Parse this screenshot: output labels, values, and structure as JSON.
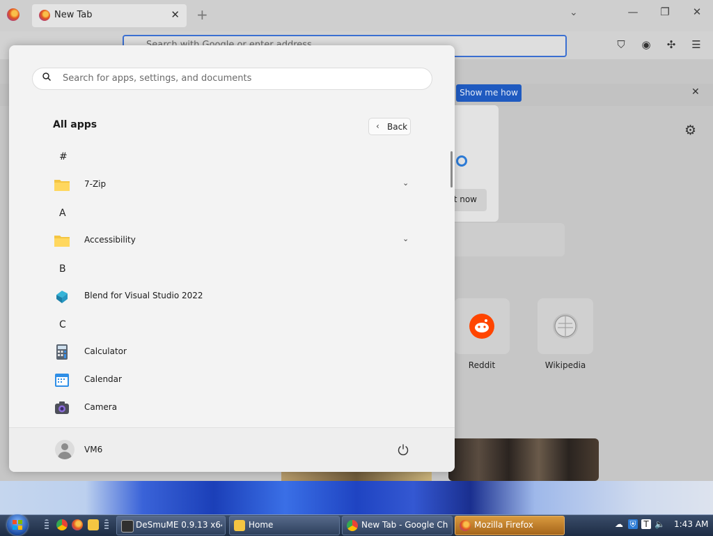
{
  "browser": {
    "tab_title": "New Tab",
    "tab_close": "✕",
    "new_tab": "+",
    "address_placeholder": "Search with Google or enter address",
    "notification_button": "Show me how",
    "popup_button": "t now",
    "shortcuts": [
      {
        "label": "Reddit",
        "icon": "reddit-icon"
      },
      {
        "label": "Wikipedia",
        "icon": "wikipedia-icon"
      }
    ]
  },
  "start_menu": {
    "search_placeholder": "Search for apps, settings, and documents",
    "header": "All apps",
    "back_label": "Back",
    "sections": [
      {
        "letter": "#",
        "apps": [
          {
            "name": "7-Zip",
            "icon": "folder-icon",
            "expandable": true
          }
        ]
      },
      {
        "letter": "A",
        "apps": [
          {
            "name": "Accessibility",
            "icon": "folder-icon",
            "expandable": true
          }
        ]
      },
      {
        "letter": "B",
        "apps": [
          {
            "name": "Blend for Visual Studio 2022",
            "icon": "blend-icon",
            "expandable": false
          }
        ]
      },
      {
        "letter": "C",
        "apps": [
          {
            "name": "Calculator",
            "icon": "calculator-icon",
            "expandable": false
          },
          {
            "name": "Calendar",
            "icon": "calendar-icon",
            "expandable": false
          },
          {
            "name": "Camera",
            "icon": "camera-icon",
            "expandable": false
          }
        ]
      }
    ],
    "user_name": "VM6"
  },
  "taskbar": {
    "tasks": [
      {
        "label": "DeSmuME 0.9.13 x64...",
        "icon": "desmume-icon",
        "active": false
      },
      {
        "label": "Home",
        "icon": "folder-icon",
        "active": false
      },
      {
        "label": "New Tab - Google Ch...",
        "icon": "chrome-icon",
        "active": false
      },
      {
        "label": "Mozilla Firefox",
        "icon": "firefox-icon",
        "active": true
      }
    ],
    "clock": "1:43 AM"
  },
  "colors": {
    "accent_blue": "#1f5ac0",
    "start_menu_bg": "#f3f3f3",
    "taskbar_active": "#d99a3e"
  }
}
